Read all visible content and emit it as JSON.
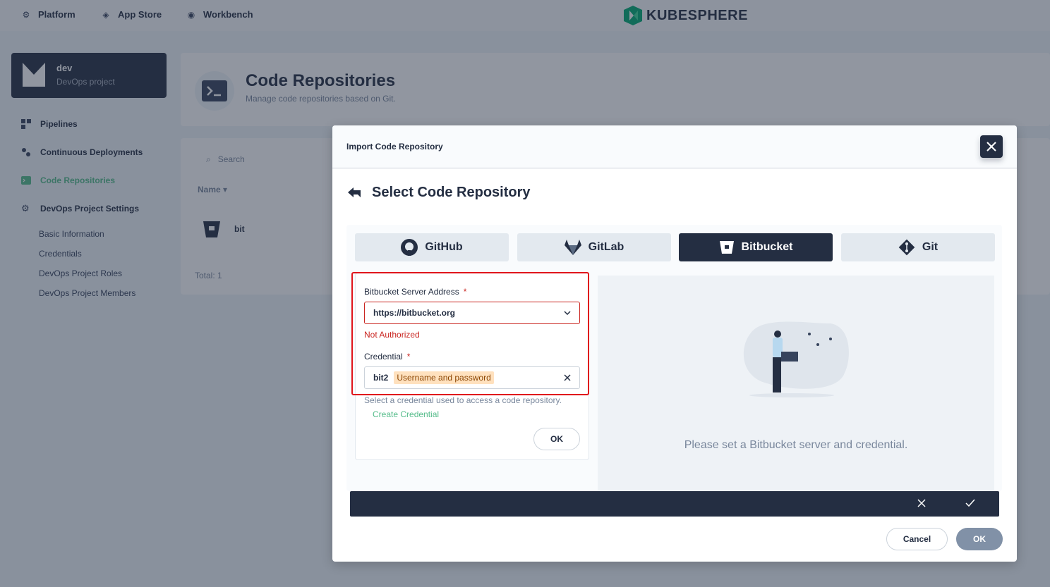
{
  "topnav": {
    "platform": "Platform",
    "app_store": "App Store",
    "workbench": "Workbench",
    "brand": "KUBESPHERE"
  },
  "project": {
    "name": "dev",
    "type": "DevOps project"
  },
  "sidebar": {
    "items": [
      {
        "label": "Pipelines"
      },
      {
        "label": "Continuous Deployments"
      },
      {
        "label": "Code Repositories"
      },
      {
        "label": "DevOps Project Settings"
      }
    ],
    "subitems": [
      {
        "label": "Basic Information"
      },
      {
        "label": "Credentials"
      },
      {
        "label": "DevOps Project Roles"
      },
      {
        "label": "DevOps Project Members"
      }
    ]
  },
  "page": {
    "title": "Code Repositories",
    "subtitle": "Manage code repositories based on Git."
  },
  "list": {
    "search_placeholder": "Search",
    "column_name": "Name",
    "rows": [
      {
        "name": "bit"
      }
    ],
    "total": "Total: 1"
  },
  "modal": {
    "title": "Import Code Repository",
    "section_title": "Select Code Repository",
    "tabs": [
      {
        "label": "GitHub"
      },
      {
        "label": "GitLab"
      },
      {
        "label": "Bitbucket",
        "active": true
      },
      {
        "label": "Git"
      }
    ],
    "form": {
      "server_label": "Bitbucket Server Address",
      "server_value": "https://bitbucket.org",
      "server_error": "Not Authorized",
      "credential_label": "Credential",
      "credential_value": "bit2",
      "credential_type": "Username and password",
      "help_text": "Select a credential used to access a code repository.",
      "create_link": "Create Credential",
      "ok_label": "OK"
    },
    "preview_text": "Please set a Bitbucket server and credential.",
    "cancel_label": "Cancel",
    "ok_label": "OK"
  }
}
